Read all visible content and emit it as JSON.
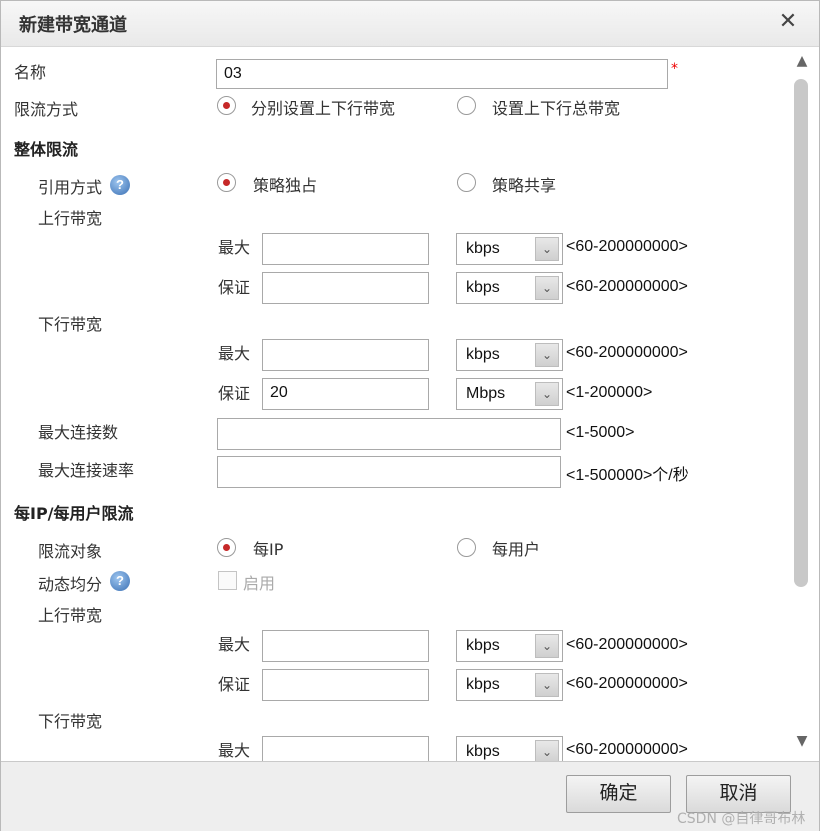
{
  "dialog": {
    "title": "新建带宽通道"
  },
  "form": {
    "name_label": "名称",
    "name_value": "03",
    "required_mark": "*",
    "limit_mode_label": "限流方式",
    "limit_mode_options": [
      "分别设置上下行带宽",
      "设置上下行总带宽"
    ],
    "limit_mode_selected": 0
  },
  "overall": {
    "section_title": "整体限流",
    "ref_mode_label": "引用方式",
    "ref_mode_options": [
      "策略独占",
      "策略共享"
    ],
    "ref_mode_selected": 0,
    "up_label": "上行带宽",
    "up_max": {
      "label": "最大",
      "value": "",
      "unit": "kbps",
      "range": "<60-200000000>"
    },
    "up_guarantee": {
      "label": "保证",
      "value": "",
      "unit": "kbps",
      "range": "<60-200000000>"
    },
    "down_label": "下行带宽",
    "down_max": {
      "label": "最大",
      "value": "",
      "unit": "kbps",
      "range": "<60-200000000>"
    },
    "down_guarantee": {
      "label": "保证",
      "value": "20",
      "unit": "Mbps",
      "range": "<1-200000>"
    },
    "max_conn_label": "最大连接数",
    "max_conn_value": "",
    "max_conn_range": "<1-5000>",
    "max_conn_rate_label": "最大连接速率",
    "max_conn_rate_value": "",
    "max_conn_rate_range": "<1-500000>个/秒"
  },
  "per_user": {
    "section_title": "每IP/每用户限流",
    "target_label": "限流对象",
    "target_options": [
      "每IP",
      "每用户"
    ],
    "target_selected": 0,
    "dynamic_label": "动态均分",
    "enable_label": "启用",
    "up_label": "上行带宽",
    "up_max": {
      "label": "最大",
      "value": "",
      "unit": "kbps",
      "range": "<60-200000000>"
    },
    "up_guarantee": {
      "label": "保证",
      "value": "",
      "unit": "kbps",
      "range": "<60-200000000>"
    },
    "down_label": "下行带宽",
    "down_max": {
      "label": "最大",
      "value": "",
      "unit": "kbps",
      "range": "<60-200000000>"
    }
  },
  "icons": {
    "help": "?",
    "close": "✕",
    "dropdown": "⌄",
    "scroll_up": "▲",
    "scroll_down": "▼"
  },
  "footer": {
    "ok_label": "确定",
    "cancel_label": "取消",
    "watermark": "CSDN @自律哥布林"
  },
  "colors": {
    "radio_selected": "#c62828",
    "required": "#e00000"
  }
}
